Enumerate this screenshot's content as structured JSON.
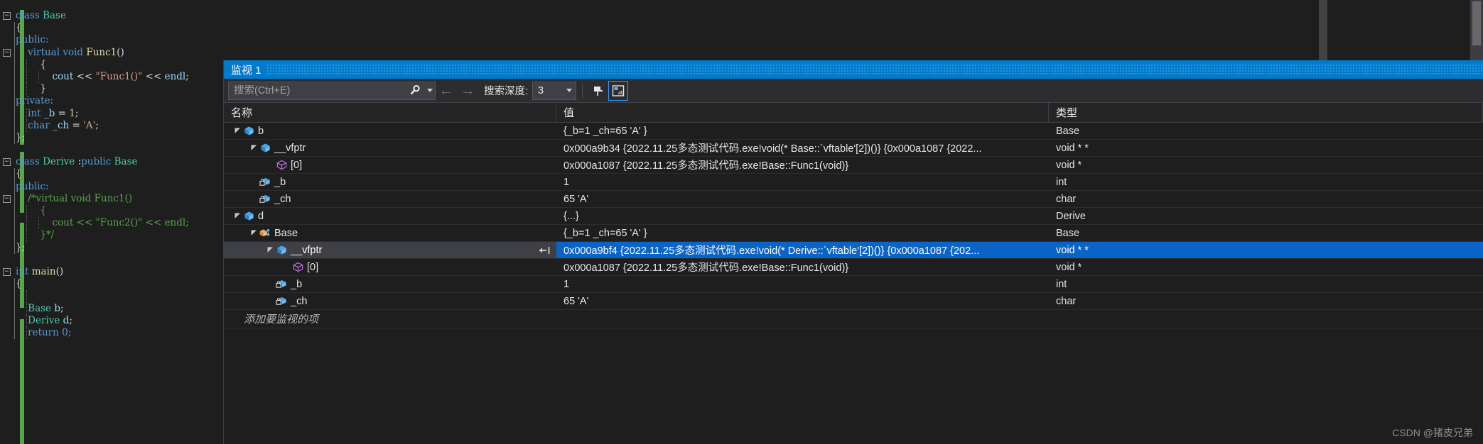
{
  "editor": {
    "lines": [
      {
        "indent": 0,
        "fold": "minus",
        "tokens": [
          {
            "t": "class ",
            "c": "key"
          },
          {
            "t": "Base",
            "c": "type"
          }
        ]
      },
      {
        "indent": 1,
        "tokens": [
          {
            "t": "{",
            "c": "punc"
          }
        ]
      },
      {
        "indent": 1,
        "tokens": [
          {
            "t": "public:",
            "c": "key"
          }
        ]
      },
      {
        "indent": 1,
        "fold": "minus",
        "tokens": [
          {
            "t": "    virtual void ",
            "c": "key"
          },
          {
            "t": "Func1",
            "c": "fn"
          },
          {
            "t": "()",
            "c": "punc"
          }
        ]
      },
      {
        "indent": 2,
        "tokens": [
          {
            "t": "        {",
            "c": "punc"
          }
        ]
      },
      {
        "indent": 3,
        "tokens": [
          {
            "t": "            cout ",
            "c": "id"
          },
          {
            "t": "<< ",
            "c": "op"
          },
          {
            "t": "\"Func1()\"",
            "c": "str"
          },
          {
            "t": " << ",
            "c": "op"
          },
          {
            "t": "endl",
            "c": "id"
          },
          {
            "t": ";",
            "c": "punc"
          }
        ]
      },
      {
        "indent": 2,
        "tokens": [
          {
            "t": "        }",
            "c": "punc"
          }
        ]
      },
      {
        "indent": 1,
        "tokens": [
          {
            "t": "private:",
            "c": "key"
          }
        ]
      },
      {
        "indent": 2,
        "tokens": [
          {
            "t": "    int ",
            "c": "key"
          },
          {
            "t": "_b",
            "c": "id"
          },
          {
            "t": " = ",
            "c": "op"
          },
          {
            "t": "1",
            "c": "num"
          },
          {
            "t": ";",
            "c": "punc"
          }
        ]
      },
      {
        "indent": 2,
        "tokens": [
          {
            "t": "    char ",
            "c": "key"
          },
          {
            "t": "_ch",
            "c": "id"
          },
          {
            "t": " = ",
            "c": "op"
          },
          {
            "t": "'A'",
            "c": "str"
          },
          {
            "t": ";",
            "c": "punc"
          }
        ]
      },
      {
        "indent": 1,
        "tokens": [
          {
            "t": "};",
            "c": "punc"
          }
        ]
      },
      {
        "indent": 0,
        "tokens": []
      },
      {
        "indent": 0,
        "fold": "minus",
        "tokens": [
          {
            "t": "class ",
            "c": "key"
          },
          {
            "t": "Derive ",
            "c": "type"
          },
          {
            "t": ":",
            "c": "punc"
          },
          {
            "t": "public ",
            "c": "key"
          },
          {
            "t": "Base",
            "c": "type"
          }
        ]
      },
      {
        "indent": 1,
        "tokens": [
          {
            "t": "{",
            "c": "punc"
          }
        ]
      },
      {
        "indent": 1,
        "tokens": [
          {
            "t": "public:",
            "c": "key"
          }
        ]
      },
      {
        "indent": 1,
        "fold": "minus",
        "tokens": [
          {
            "t": "    /*virtual void Func1()",
            "c": "com"
          }
        ]
      },
      {
        "indent": 2,
        "tokens": [
          {
            "t": "        {",
            "c": "com"
          }
        ]
      },
      {
        "indent": 3,
        "tokens": [
          {
            "t": "            cout << \"Func2()\" << endl;",
            "c": "com"
          }
        ]
      },
      {
        "indent": 2,
        "tokens": [
          {
            "t": "        }*/",
            "c": "com"
          }
        ]
      },
      {
        "indent": 1,
        "tokens": [
          {
            "t": "};",
            "c": "punc"
          }
        ]
      },
      {
        "indent": 0,
        "tokens": []
      },
      {
        "indent": 0,
        "fold": "minus",
        "tokens": [
          {
            "t": "int ",
            "c": "key"
          },
          {
            "t": "main",
            "c": "fn"
          },
          {
            "t": "()",
            "c": "punc"
          }
        ]
      },
      {
        "indent": 1,
        "tokens": [
          {
            "t": "{",
            "c": "punc"
          }
        ]
      },
      {
        "indent": 2,
        "tokens": []
      },
      {
        "indent": 2,
        "tokens": [
          {
            "t": "    Base ",
            "c": "type"
          },
          {
            "t": "b",
            "c": "id"
          },
          {
            "t": ";",
            "c": "punc"
          }
        ]
      },
      {
        "indent": 2,
        "tokens": [
          {
            "t": "    Derive ",
            "c": "type"
          },
          {
            "t": "d",
            "c": "id"
          },
          {
            "t": ";",
            "c": "punc"
          }
        ]
      },
      {
        "indent": 2,
        "tokens": [
          {
            "t": "    return 0;",
            "c": "key"
          }
        ]
      }
    ]
  },
  "watch": {
    "title": "监视 1",
    "toolbar": {
      "search_placeholder": "搜索(Ctrl+E)",
      "search_value": "",
      "search_icon": "magnifier-icon",
      "dropdown_icon": "chevron-down-icon",
      "back_icon": "arrow-left-icon",
      "forward_icon": "arrow-right-icon",
      "depth_label": "搜索深度:",
      "depth_value": "3",
      "pin_button_icon": "pin-icon",
      "hex_button_icon": "hex-display-icon"
    },
    "columns": [
      "名称",
      "值",
      "类型"
    ],
    "rows": [
      {
        "depth": 0,
        "twisty": "expanded",
        "icon": "class-icon",
        "name": "b",
        "value": "{_b=1 _ch=65 'A' }",
        "type": "Base",
        "selected": false
      },
      {
        "depth": 1,
        "twisty": "expanded",
        "icon": "class-icon",
        "name": "__vfptr",
        "value": "0x000a9b34 {2022.11.25多态测试代码.exe!void(* Base::`vftable'[2])()} {0x000a1087 {2022...",
        "type": "void * *",
        "selected": false
      },
      {
        "depth": 2,
        "twisty": "none",
        "icon": "element-icon",
        "name": "[0]",
        "value": "0x000a1087 {2022.11.25多态测试代码.exe!Base::Func1(void)}",
        "type": "void *",
        "selected": false
      },
      {
        "depth": 1,
        "twisty": "none",
        "icon": "private-field-icon",
        "name": "_b",
        "value": "1",
        "type": "int",
        "selected": false
      },
      {
        "depth": 1,
        "twisty": "none",
        "icon": "private-field-icon",
        "name": "_ch",
        "value": "65 'A'",
        "type": "char",
        "selected": false
      },
      {
        "depth": 0,
        "twisty": "expanded",
        "icon": "class-icon",
        "name": "d",
        "value": "{...}",
        "type": "Derive",
        "selected": false
      },
      {
        "depth": 1,
        "twisty": "expanded",
        "icon": "base-class-icon",
        "name": "Base",
        "value": "{_b=1 _ch=65 'A' }",
        "type": "Base",
        "selected": false
      },
      {
        "depth": 2,
        "twisty": "expanded",
        "icon": "class-icon",
        "name": "__vfptr",
        "value": "0x000a9bf4 {2022.11.25多态测试代码.exe!void(* Derive::`vftable'[2])()} {0x000a1087 {202...",
        "type": "void * *",
        "selected": true,
        "pin": "pin-icon"
      },
      {
        "depth": 3,
        "twisty": "none",
        "icon": "element-icon",
        "name": "[0]",
        "value": "0x000a1087 {2022.11.25多态测试代码.exe!Base::Func1(void)}",
        "type": "void *",
        "selected": false
      },
      {
        "depth": 2,
        "twisty": "none",
        "icon": "private-field-icon",
        "name": "_b",
        "value": "1",
        "type": "int",
        "selected": false
      },
      {
        "depth": 2,
        "twisty": "none",
        "icon": "private-field-icon",
        "name": "_ch",
        "value": "65 'A'",
        "type": "char",
        "selected": false
      }
    ],
    "add_item_placeholder": "添加要监视的项"
  },
  "watermark": "CSDN @猪皮兄弟"
}
